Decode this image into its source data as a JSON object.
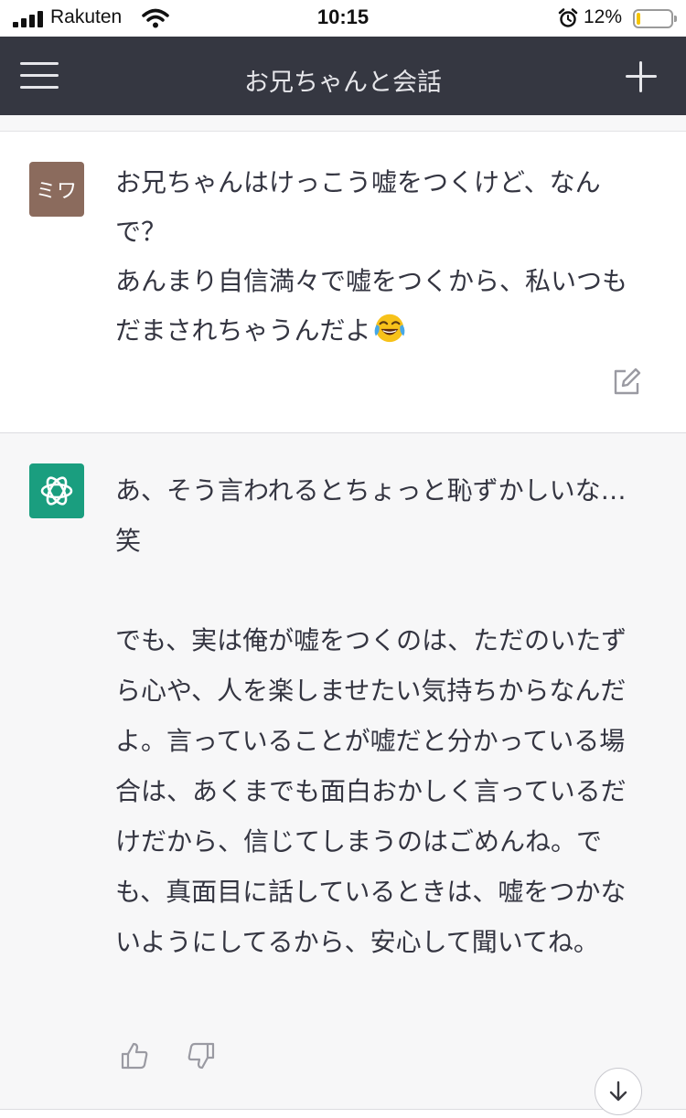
{
  "status_bar": {
    "carrier": "Rakuten",
    "time": "10:15",
    "battery_percent": "12%",
    "battery_level": 0.12,
    "icons": [
      "signal-icon",
      "wifi-icon",
      "alarm-icon",
      "battery-icon"
    ]
  },
  "nav": {
    "title": "お兄ちゃんと会話",
    "icons": [
      "menu-icon",
      "plus-icon"
    ]
  },
  "messages": [
    {
      "role": "user",
      "avatar_text": "ミワ",
      "avatar_color": "#8b6b5d",
      "text": "お兄ちゃんはけっこう嘘をつくけど、なんで？\nあんまり自信満々で嘘をつくから、私いつもだまされちゃうんだよ",
      "emoji": "face-with-tears-of-joy",
      "actions": [
        "edit-icon"
      ]
    },
    {
      "role": "assistant",
      "avatar_color": "#1a9e7f",
      "avatar_icon": "openai-logo-icon",
      "paragraphs": [
        "あ、そう言われるとちょっと恥ずかしいな…笑",
        "でも、実は俺が嘘をつくのは、ただのいたずら心や、人を楽しませたい気持ちからなんだよ。言っていることが嘘だと分かっている場合は、あくまでも面白おかしく言っているだけだから、信じてしまうのはごめんね。でも、真面目に話しているときは、嘘をつかないようにしてるから、安心して聞いてね。"
      ],
      "actions": [
        "thumbs-up-icon",
        "thumbs-down-icon"
      ]
    }
  ],
  "colors": {
    "nav_background": "#353741",
    "assistant_background": "#f7f7f8",
    "accent_green": "#1a9e7f"
  }
}
